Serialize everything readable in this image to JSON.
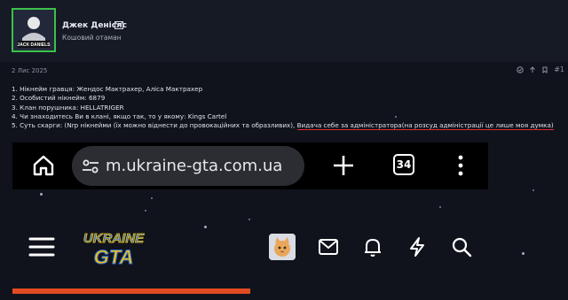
{
  "post": {
    "author_name": "Джек Деніслс",
    "author_title": "Кошовий отаман",
    "avatar_caption": "JACK DANIELS",
    "date": "2 Лис 2025",
    "post_number": "#1",
    "lines": [
      "1. Нікнейм гравця: Жендос Мактрахер, Аліса Мактрахер",
      "2. Особистий нікнейм: 6879",
      "3. Клан порушника: HELLATRIGER",
      "4. Чи знаходитесь Ви в клані, якщо так, то у якому: Kings Cartel"
    ],
    "line5_prefix": "5. Суть скарги: (Nrp нікнейми (їх можно віднести до провокаційних та образливих), ",
    "line5_underlined": "Видача себе за адміністратора(на розсуд адміністрації це лише моя думка)"
  },
  "browser": {
    "url": "m.ukraine-gta.com.ua",
    "tab_count": "34"
  },
  "site": {
    "logo_top": "UKRAINE",
    "logo_bottom": "GTA",
    "page_progress": 0.5
  },
  "colors": {
    "background": "#10131c",
    "avatar_border": "#3ac24a",
    "underline": "#e0282e",
    "progress": "#e24b22",
    "logo_blue": "#2f6fe0",
    "logo_yellow": "#f5c400"
  },
  "icons": {
    "home": "home-icon",
    "tune": "tune-icon",
    "plus": "plus-icon",
    "more": "more-vert-icon",
    "menu": "menu-icon",
    "mail": "mail-icon",
    "bell": "bell-icon",
    "bolt": "bolt-icon",
    "search": "search-icon"
  }
}
